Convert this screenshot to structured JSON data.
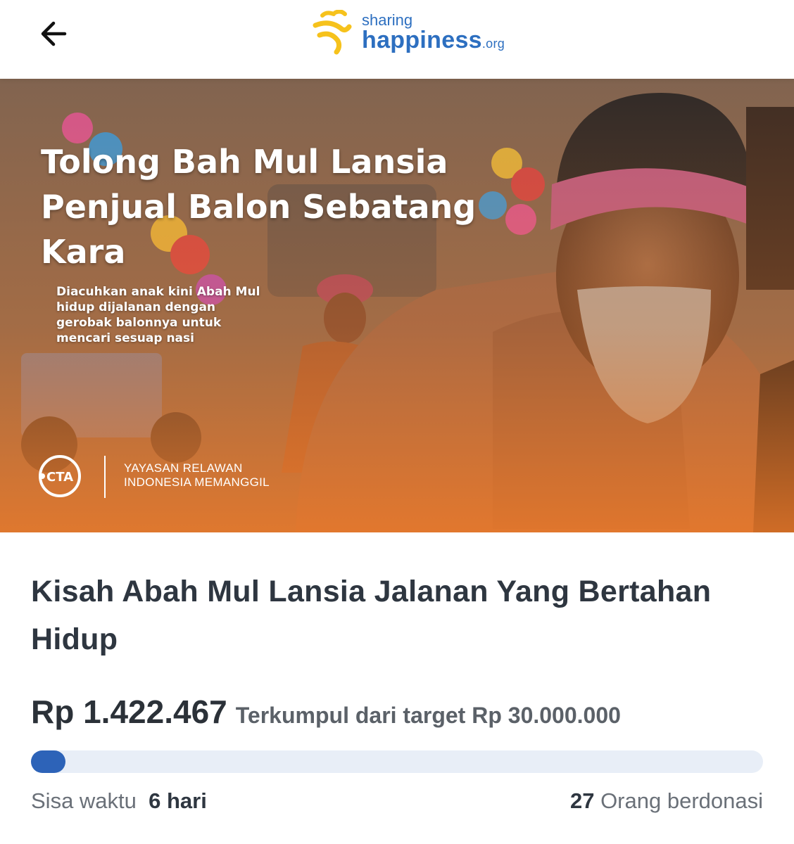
{
  "header": {
    "back_icon": "arrow-left-icon",
    "logo": {
      "line1": "sharing",
      "line2": "happiness",
      "suffix": ".org",
      "accent_yellow": "#F6C21C",
      "accent_blue": "#2D6FC0"
    }
  },
  "hero": {
    "title": "Tolong Bah Mul Lansia Penjual Balon Sebatang Kara",
    "subtitle": "Diacuhkan anak kini Abah Mul hidup dijalanan dengan gerobak balonnya untuk mencari sesuap nasi",
    "cta_logo": "CTA",
    "org_line1": "YAYASAN RELAWAN",
    "org_line2": "INDONESIA MEMANGGIL"
  },
  "campaign": {
    "title": "Kisah Abah Mul Lansia Jalanan Yang Bertahan Hidup",
    "amount": "Rp 1.422.467",
    "target_text": "Terkumpul dari target Rp 30.000.000",
    "progress_fraction": 0.047,
    "time_left_label": "Sisa waktu",
    "time_left_value": "6 hari",
    "donors_count": "27",
    "donors_label": "Orang berdonasi",
    "progress_color": "#2D63B8"
  }
}
